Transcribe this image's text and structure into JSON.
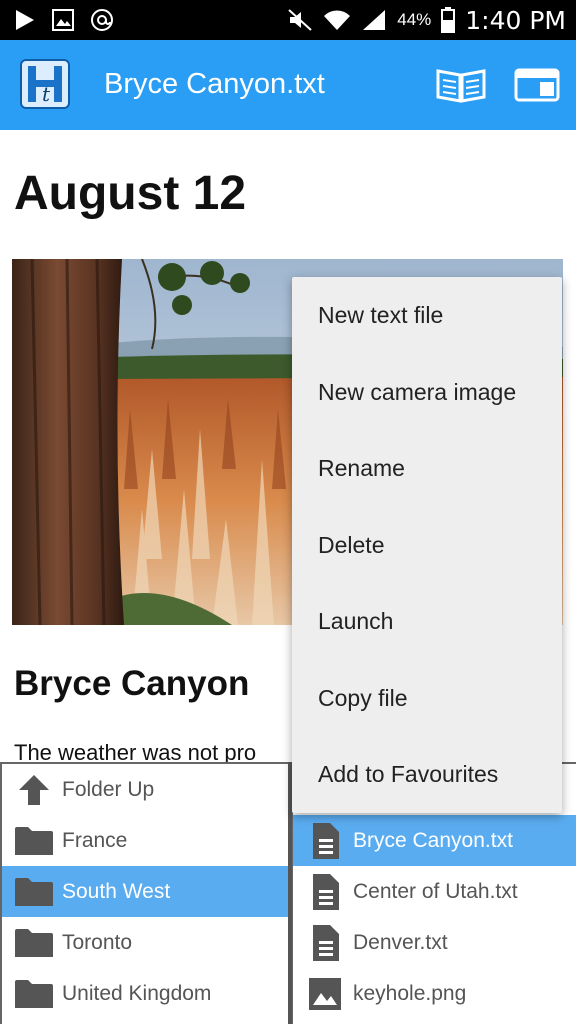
{
  "status_bar": {
    "battery": "44%",
    "time": "1:40 PM"
  },
  "app_bar": {
    "title": "Bryce Canyon.txt",
    "logo_letter": "t"
  },
  "document": {
    "heading": "August 12",
    "subheading": "Bryce Canyon",
    "paragraph": "The weather was not pro"
  },
  "menu": {
    "items": [
      "New text file",
      "New camera image",
      "Rename",
      "Delete",
      "Launch",
      "Copy file",
      "Add to Favourites"
    ]
  },
  "folders": {
    "items": [
      {
        "label": "Folder Up",
        "icon": "arrow-up-icon"
      },
      {
        "label": "France",
        "icon": "folder-icon"
      },
      {
        "label": "South West",
        "icon": "folder-icon",
        "selected": true
      },
      {
        "label": "Toronto",
        "icon": "folder-icon"
      },
      {
        "label": "United Kingdom",
        "icon": "folder-icon"
      }
    ]
  },
  "files": {
    "items": [
      {
        "label": "Bryce Canyon.txt",
        "icon": "text-file-icon",
        "selected": true
      },
      {
        "label": "Center of Utah.txt",
        "icon": "text-file-icon"
      },
      {
        "label": "Denver.txt",
        "icon": "text-file-icon"
      },
      {
        "label": "keyhole.png",
        "icon": "image-file-icon"
      }
    ]
  },
  "colors": {
    "app_bar": "#2a9df4",
    "selection": "#5aacf0",
    "menu_background": "#eeeeee"
  }
}
